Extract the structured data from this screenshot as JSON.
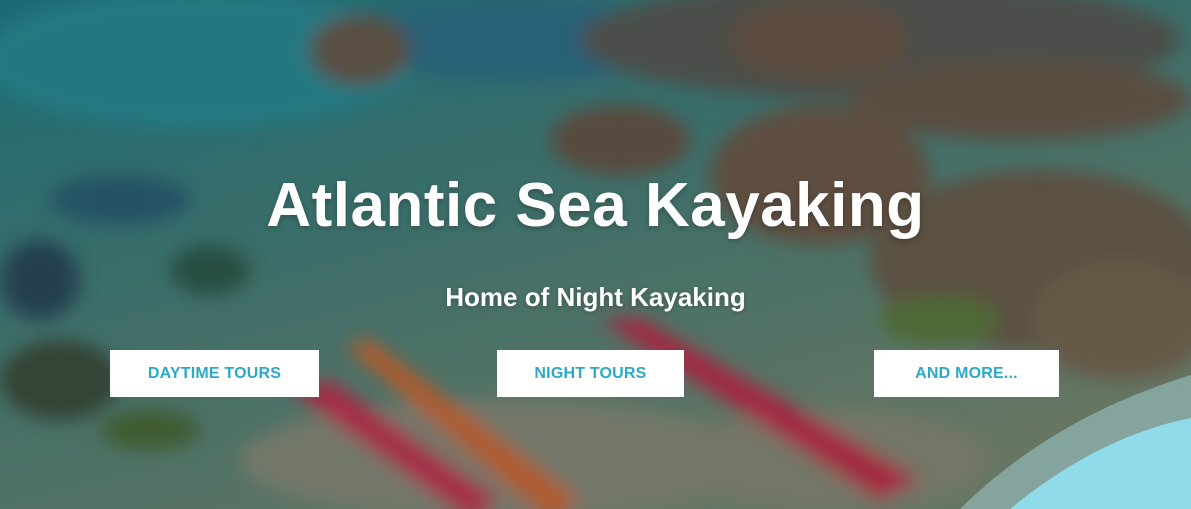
{
  "hero": {
    "title": "Atlantic Sea Kayaking",
    "subtitle": "Home of Night Kayaking",
    "background_image": "blurred-coastal-water-with-rocks-and-kayaks",
    "colors": {
      "accent": "#2aa9c9",
      "button_bg": "#ffffff",
      "text": "#ffffff",
      "wave_light": "#8fdbe9"
    }
  },
  "buttons": {
    "daytime": "DAYTIME TOURS",
    "night": "NIGHT TOURS",
    "more": "AND MORE..."
  }
}
